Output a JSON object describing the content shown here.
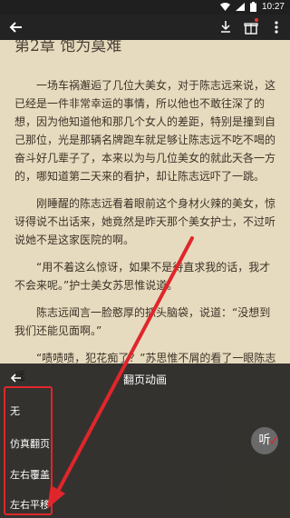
{
  "status_bar": {
    "time": "10:27"
  },
  "chapter": {
    "title": "第2章 饱为莫难"
  },
  "paragraphs": [
    "一场车祸邂逅了几位大美女，对于陈志远来说，这已经是一件非常幸运的事情，所以他也不敢往深了的想，因为他知道他和那几个女人的差距，特别是撞到自己那位，光是那辆名牌跑车就足够让陈志远不吃不喝的奋斗好几辈子了，本来以为与几位美女的就此天各一方的，哪知道第二天来的看护，却让陈志远吓了一跳。",
    "刚睡醒的陈志远看着眼前这个身材火辣的美女，惊讶得说不出话来，她竟然是昨天那个美女护士，不过听说她不是这家医院的啊。",
    "“用不着这么惊讶，如果不是待直求我的话，我才不会来呢。”护士美女苏思惟说道。",
    "陈志远闻言一脸憨厚的抓头脑袋，说道：“没想到我们还能见面啊。”",
    "“啧啧啧，犯花痴了？”苏思惟不屑的看了一眼陈志远"
  ],
  "page_turn_panel": {
    "title": "翻页动画",
    "options": [
      "无",
      "仿真翻页",
      "左右覆盖",
      "左右平移"
    ],
    "listen_label": "听"
  },
  "colors": {
    "annotation": "#e0262b",
    "page_bg": "#e7dbbf"
  }
}
